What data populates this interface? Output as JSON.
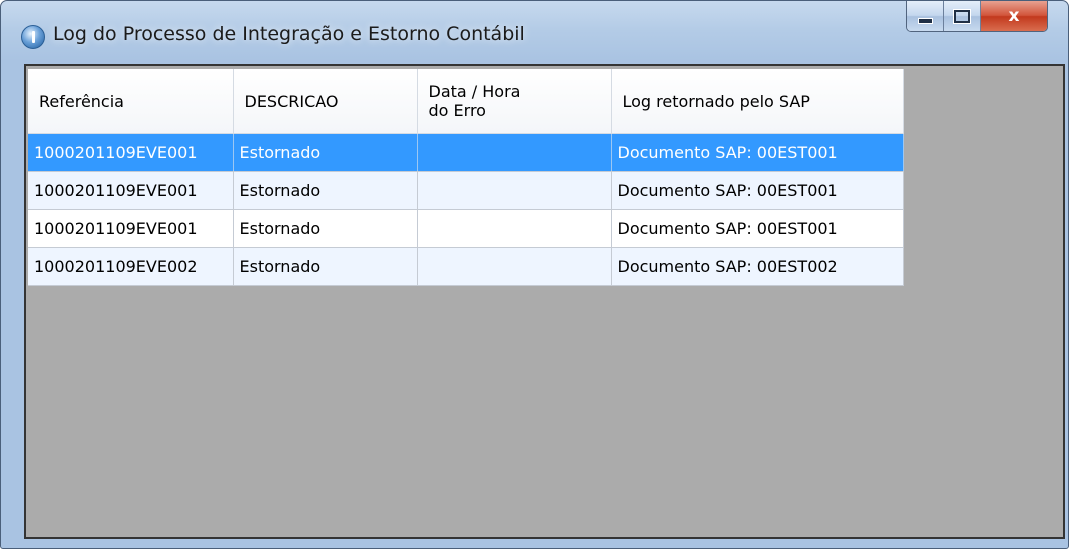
{
  "window": {
    "title": "Log do Processo de Integração e Estorno Contábil",
    "close_glyph": "x"
  },
  "icons": {
    "app": "app-globe-icon",
    "minimize": "minimize-icon",
    "maximize": "maximize-icon",
    "close": "close-icon"
  },
  "colors": {
    "selection": "#3399ff",
    "client_background": "#ababab",
    "alt_row": "#eef5ff"
  },
  "grid": {
    "columns": [
      "Referência",
      "DESCRICAO",
      "Data / Hora\ndo Erro",
      "Log retornado pelo SAP"
    ],
    "rows": [
      {
        "referencia": "1000201109EVE001",
        "descricao": "Estornado",
        "data_hora": "",
        "log_sap": "Documento SAP: 00EST001",
        "selected": true
      },
      {
        "referencia": "1000201109EVE001",
        "descricao": "Estornado",
        "data_hora": "",
        "log_sap": "Documento SAP: 00EST001",
        "selected": false
      },
      {
        "referencia": "1000201109EVE001",
        "descricao": "Estornado",
        "data_hora": "",
        "log_sap": "Documento SAP: 00EST001",
        "selected": false
      },
      {
        "referencia": "1000201109EVE002",
        "descricao": "Estornado",
        "data_hora": "",
        "log_sap": "Documento SAP: 00EST002",
        "selected": false
      }
    ]
  }
}
